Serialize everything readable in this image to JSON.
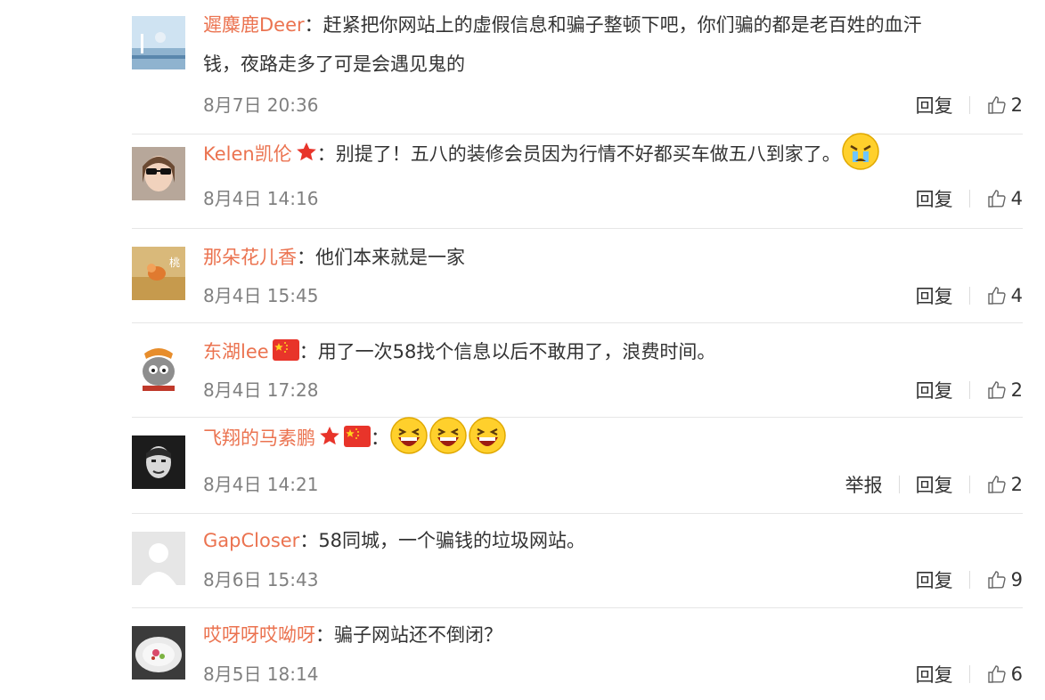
{
  "colon": "：",
  "actions": {
    "reply_label": "回复",
    "report_label": "举报"
  },
  "colors": {
    "username": "#eb7350",
    "text": "#333333",
    "meta": "#808080",
    "divider": "#e6e6e6"
  },
  "comments": [
    {
      "user": "遲麋鹿Deer",
      "text_line1": "赶紧把你网站上的虚假信息和骗子整顿下吧，你们骗的都是老百姓的血汗",
      "text_line2": "钱，夜路走多了可是会遇见鬼的",
      "time": "8月7日 20:36",
      "likes": "2",
      "badges": []
    },
    {
      "user": "Kelen凯伦",
      "text": "别提了！五八的装修会员因为行情不好都买车做五八到家了。",
      "time": "8月4日 14:16",
      "likes": "4",
      "badges": [
        "star-badge-icon"
      ],
      "emoji": [
        "crying-emoji-icon"
      ]
    },
    {
      "user": "那朵花儿香",
      "text": "他们本来就是一家",
      "time": "8月4日 15:45",
      "likes": "4",
      "badges": []
    },
    {
      "user": "东湖lee",
      "text": "用了一次58找个信息以后不敢用了，浪费时间。",
      "time": "8月4日 17:28",
      "likes": "2",
      "badges": [
        "china-flag-icon"
      ]
    },
    {
      "user": "飞翔的马素鹏",
      "text": "",
      "time": "8月4日 14:21",
      "likes": "2",
      "badges": [
        "star-badge-icon",
        "china-flag-icon"
      ],
      "emoji": [
        "laughing-emoji-icon",
        "laughing-emoji-icon",
        "laughing-emoji-icon"
      ],
      "has_report": true
    },
    {
      "user": "GapCloser",
      "text": "58同城，一个骗钱的垃圾网站。",
      "time": "8月6日 15:43",
      "likes": "9",
      "badges": []
    },
    {
      "user": "哎呀呀哎呦呀",
      "text": "骗子网站还不倒闭？",
      "time": "8月5日 18:14",
      "likes": "6",
      "badges": []
    }
  ]
}
